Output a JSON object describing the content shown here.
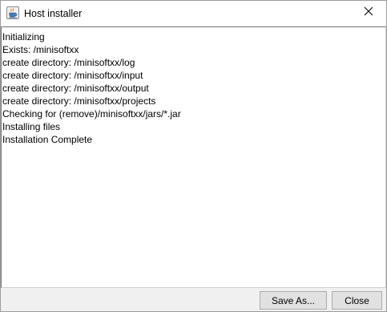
{
  "window": {
    "title": "Host installer",
    "app_icon": "java-coffee-cup-icon",
    "close_icon": "close-icon"
  },
  "log": {
    "lines": [
      "Initializing",
      "Exists: /minisoftxx",
      "create directory: /minisoftxx/log",
      "create directory: /minisoftxx/input",
      "create directory: /minisoftxx/output",
      "create directory: /minisoftxx/projects",
      "Checking for (remove)/minisoftxx/jars/*.jar",
      "Installing files",
      "Installation Complete"
    ]
  },
  "buttons": {
    "save_as": "Save As...",
    "close": "Close"
  }
}
